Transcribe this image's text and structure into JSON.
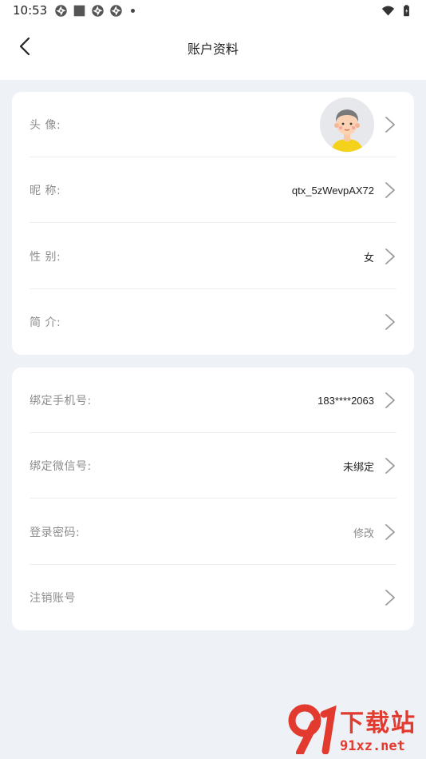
{
  "status_bar": {
    "time": "10:53",
    "icons": [
      "pinwheel-icon",
      "square-icon",
      "pinwheel-icon",
      "pinwheel-icon",
      "dot-icon"
    ],
    "right_icons": [
      "wifi-icon",
      "battery-icon"
    ]
  },
  "header": {
    "title": "账户资料",
    "back_icon": "chevron-left-icon"
  },
  "profile_card": {
    "rows": [
      {
        "label": "头 像:",
        "value": ""
      },
      {
        "label": "昵 称:",
        "value": "qtx_5zWevpAX72"
      },
      {
        "label": "性 别:",
        "value": "女"
      },
      {
        "label": "简 介:",
        "value": ""
      }
    ]
  },
  "account_card": {
    "rows": [
      {
        "label": "绑定手机号:",
        "value": "183****2063"
      },
      {
        "label": "绑定微信号:",
        "value": "未绑定"
      },
      {
        "label": "登录密码:",
        "value": "修改"
      },
      {
        "label": "注销账号",
        "value": ""
      }
    ]
  },
  "watermark": {
    "main": "下载站",
    "sub": "91xz.net"
  },
  "colors": {
    "background": "#eef1f6",
    "card": "#ffffff",
    "label": "#8c8c8c",
    "value": "#222222",
    "watermark": "#e23a2e"
  }
}
